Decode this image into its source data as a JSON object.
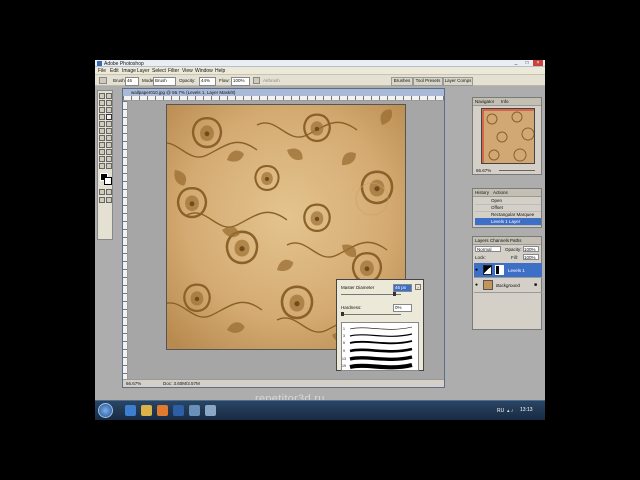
{
  "app": {
    "title": "Adobe Photoshop"
  },
  "window_controls": {
    "minimize": "_",
    "maximize": "□",
    "close": "×"
  },
  "menubar": [
    "File",
    "Edit",
    "Image",
    "Layer",
    "Select",
    "Filter",
    "View",
    "Window",
    "Help"
  ],
  "options": {
    "brush_label": "Brush:",
    "brush_size": "46",
    "mode_label": "Mode:",
    "mode_value": "Brush",
    "opacity_label": "Opacity:",
    "opacity_value": "44%",
    "flow_label": "Flow:",
    "flow_value": "100%",
    "airbrush_label": "Airbrush",
    "tabs": [
      "Brushes",
      "Tool Presets",
      "Layer Comps"
    ]
  },
  "document": {
    "title": "wallpaper010.jpg @ 66.7% (Levels 1, Layer Mask/8)",
    "zoom": "66.67%",
    "doc_size": "Doc: 3.60M/3.57M"
  },
  "brush_popup": {
    "master_diameter_label": "Master Diameter",
    "master_diameter_value": "46 px",
    "hardness_label": "Hardness:",
    "hardness_value": "0%",
    "brush_sizes": [
      "1",
      "3",
      "5",
      "9",
      "13",
      "19"
    ]
  },
  "navigator": {
    "tabs": [
      "Navigator",
      "Info"
    ],
    "zoom": "66.67%"
  },
  "history": {
    "tabs": [
      "History",
      "Actions"
    ],
    "items": [
      "Open",
      "Offset",
      "Rectangular Marquee",
      "Levels 1 Layer"
    ],
    "selected_index": 3
  },
  "layers": {
    "tabs": [
      "Layers",
      "Channels",
      "Paths"
    ],
    "blend_mode": "Normal",
    "opacity_label": "Opacity:",
    "opacity_value": "100%",
    "lock_label": "Lock:",
    "fill_label": "Fill:",
    "fill_value": "100%",
    "items": [
      {
        "name": "Levels 1",
        "selected": true
      },
      {
        "name": "Background",
        "selected": false
      }
    ]
  },
  "taskbar": {
    "language": "RU",
    "time": "13:13"
  },
  "watermark": "repetitor3d.ru",
  "colors": {
    "selection": "#3e6fc7",
    "paper": "#d7b17a",
    "pattern": "#8a6128"
  }
}
